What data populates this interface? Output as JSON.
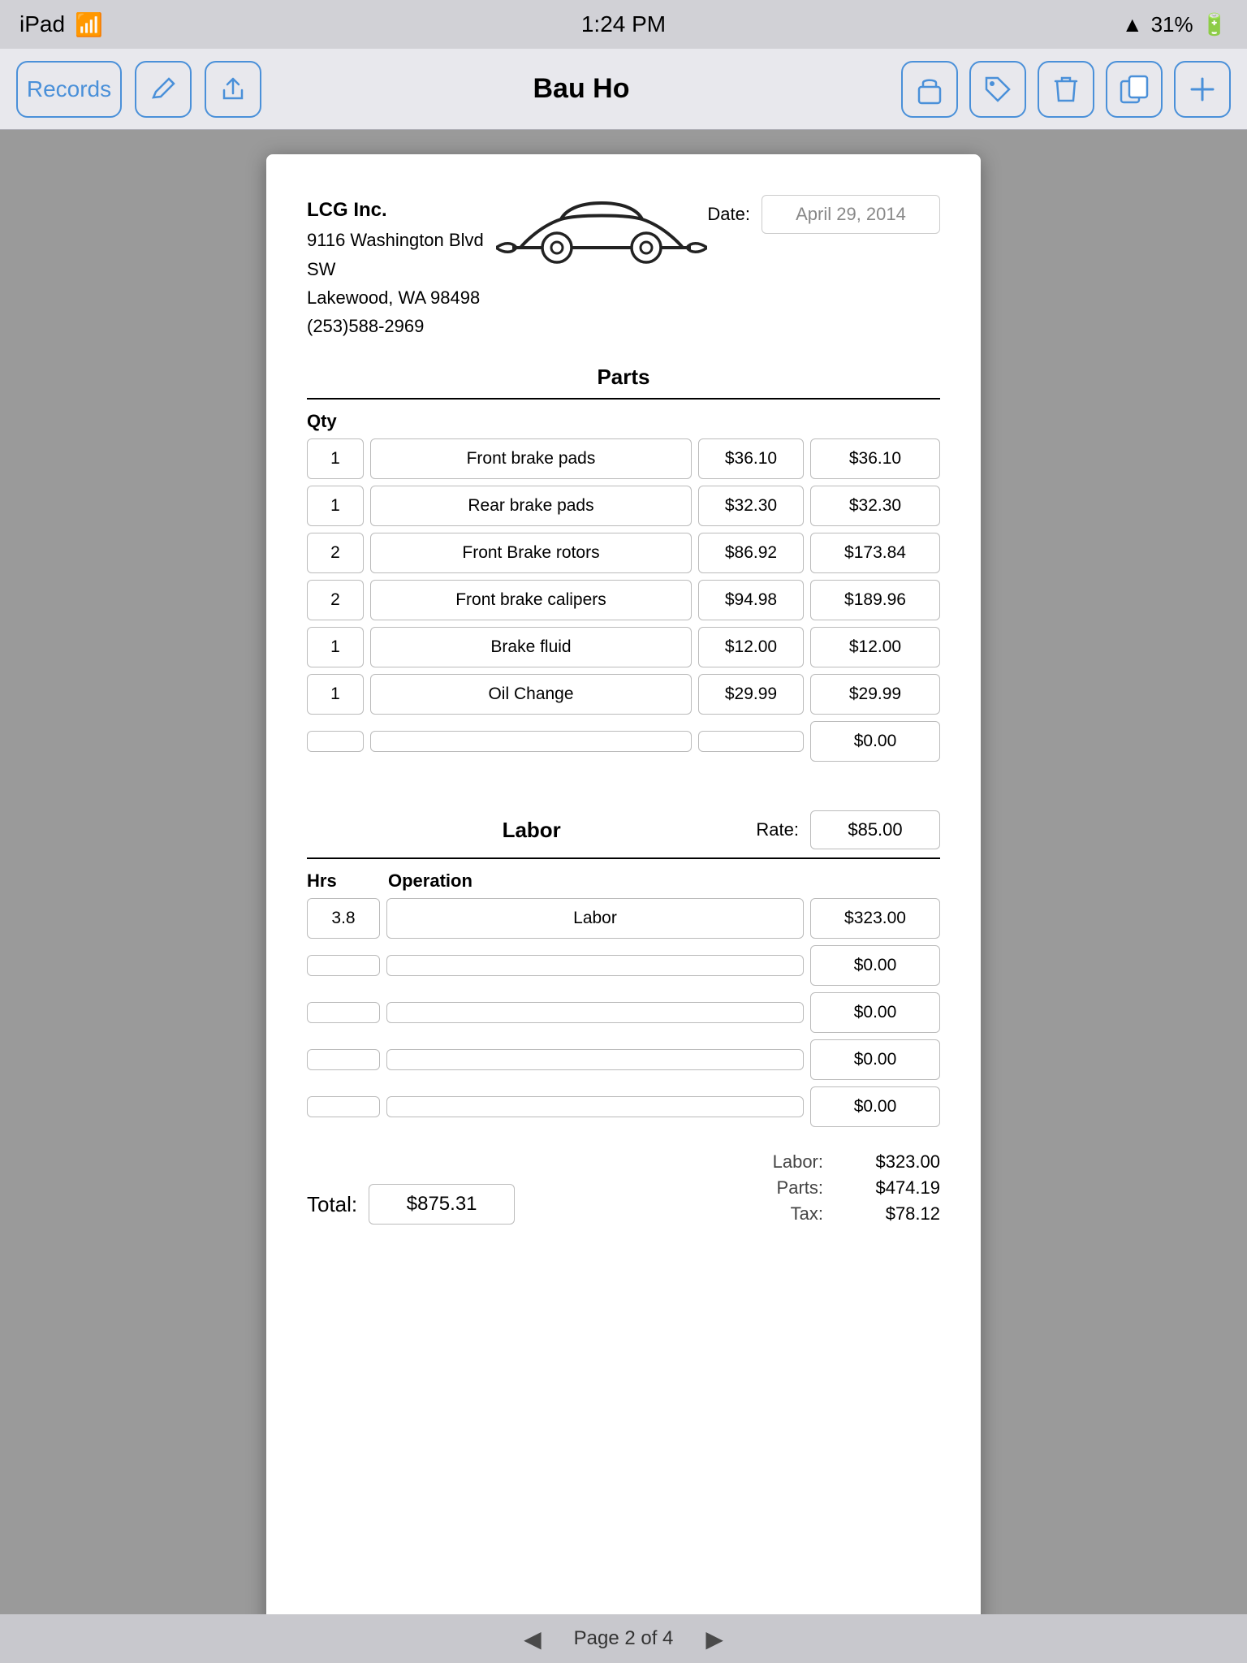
{
  "statusBar": {
    "carrier": "iPad",
    "wifi": true,
    "time": "1:24 PM",
    "signal": "31%",
    "battery": "31%"
  },
  "toolbar": {
    "records_label": "Records",
    "title": "Bau Ho"
  },
  "document": {
    "company": {
      "name": "LCG Inc.",
      "address1": "9116 Washington Blvd SW",
      "address2": "Lakewood, WA  98498",
      "phone": "(253)588-2969"
    },
    "date_label": "Date:",
    "date_value": "April 29, 2014",
    "sections": {
      "parts_title": "Parts",
      "qty_label": "Qty",
      "parts": [
        {
          "qty": "1",
          "desc": "Front brake pads",
          "price": "$36.10",
          "total": "$36.10"
        },
        {
          "qty": "1",
          "desc": "Rear brake pads",
          "price": "$32.30",
          "total": "$32.30"
        },
        {
          "qty": "2",
          "desc": "Front Brake rotors",
          "price": "$86.92",
          "total": "$173.84"
        },
        {
          "qty": "2",
          "desc": "Front brake calipers",
          "price": "$94.98",
          "total": "$189.96"
        },
        {
          "qty": "1",
          "desc": "Brake fluid",
          "price": "$12.00",
          "total": "$12.00"
        },
        {
          "qty": "1",
          "desc": "Oil Change",
          "price": "$29.99",
          "total": "$29.99"
        },
        {
          "qty": "",
          "desc": "",
          "price": "",
          "total": "$0.00"
        }
      ],
      "labor_title": "Labor",
      "rate_label": "Rate:",
      "rate_value": "$85.00",
      "hrs_label": "Hrs",
      "operation_label": "Operation",
      "labor_rows": [
        {
          "hrs": "3.8",
          "op": "Labor",
          "total": "$323.00"
        },
        {
          "hrs": "",
          "op": "",
          "total": "$0.00"
        },
        {
          "hrs": "",
          "op": "",
          "total": "$0.00"
        },
        {
          "hrs": "",
          "op": "",
          "total": "$0.00"
        },
        {
          "hrs": "",
          "op": "",
          "total": "$0.00"
        }
      ],
      "summary": {
        "labor_label": "Labor:",
        "labor_value": "$323.00",
        "parts_label": "Parts:",
        "parts_value": "$474.19",
        "tax_label": "Tax:",
        "tax_value": "$78.12",
        "total_label": "Total:",
        "total_value": "$875.31"
      }
    }
  },
  "pagination": {
    "label": "Page 2 of 4"
  }
}
